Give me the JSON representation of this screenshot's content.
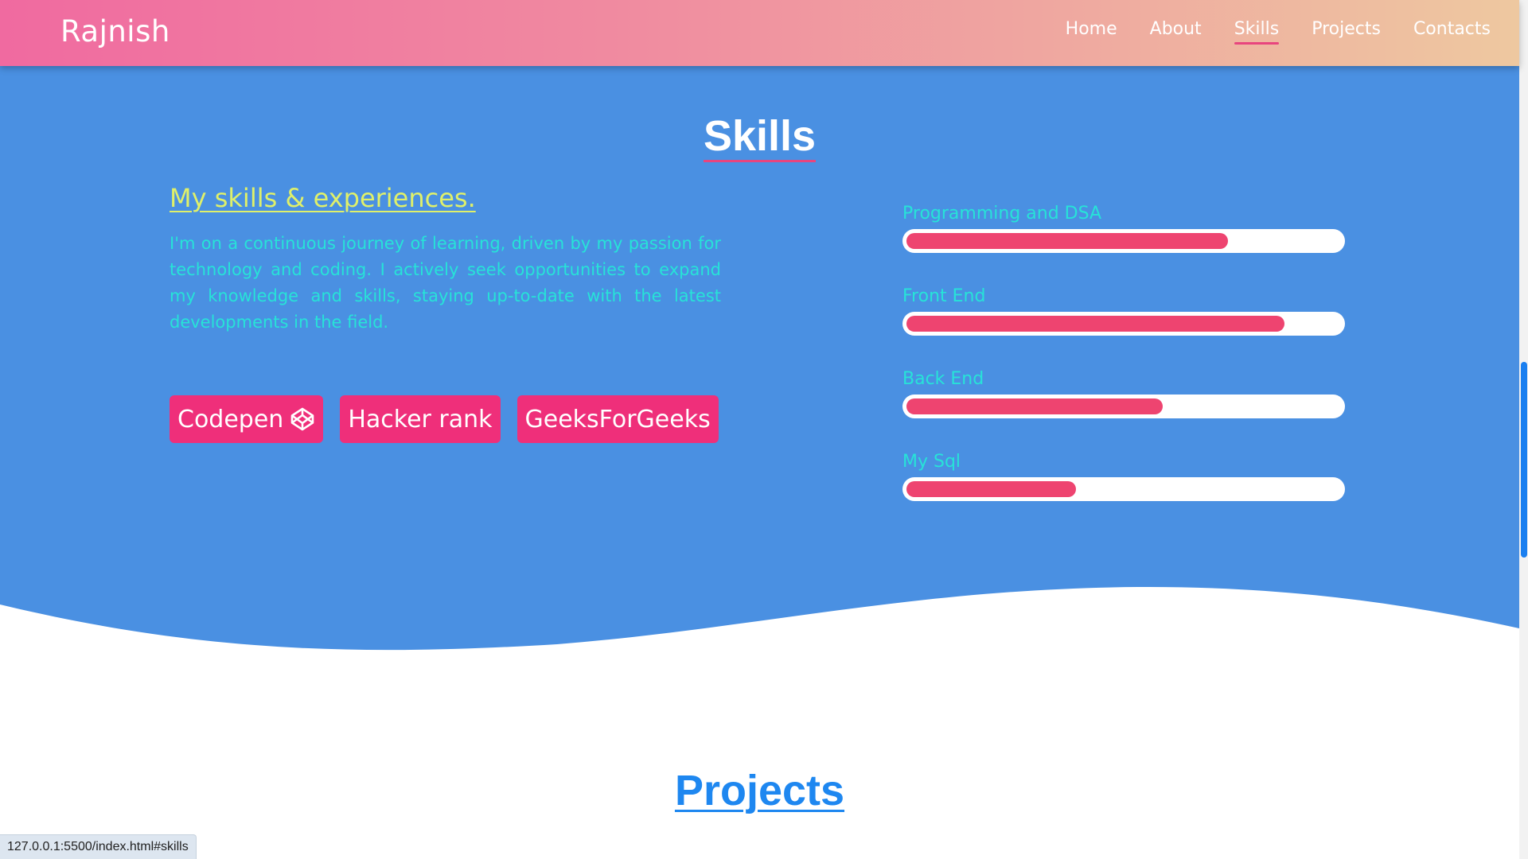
{
  "navbar": {
    "brand": "Rajnish",
    "links": [
      {
        "label": "Home",
        "active": false
      },
      {
        "label": "About",
        "active": false
      },
      {
        "label": "Skills",
        "active": true
      },
      {
        "label": "Projects",
        "active": false
      },
      {
        "label": "Contacts",
        "active": false
      }
    ]
  },
  "skills": {
    "title": "Skills",
    "subheading": "My skills & experiences.",
    "description": "I'm on a continuous journey of learning, driven by my passion for technology and coding. I actively seek opportunities to expand my knowledge and skills, staying up-to-date with the latest developments in the field.",
    "buttons": [
      {
        "label": "Codepen",
        "icon": "codepen-icon"
      },
      {
        "label": "Hacker rank"
      },
      {
        "label": "GeeksForGeeks"
      }
    ],
    "bars": [
      {
        "label": "Programming and DSA",
        "percent": 74
      },
      {
        "label": "Front End",
        "percent": 87
      },
      {
        "label": "Back End",
        "percent": 59
      },
      {
        "label": "My Sql",
        "percent": 39
      }
    ]
  },
  "projects": {
    "title": "Projects"
  },
  "status_bar": {
    "url": "127.0.0.1:5500/index.html#skills"
  },
  "colors": {
    "section_bg": "#4a90e2",
    "accent_pink": "#ef2f7a",
    "bar_fill": "#ee4470",
    "heading_yellow": "#dff06a",
    "text_cyan": "#27e3d8",
    "projects_blue": "#1e87f0"
  }
}
